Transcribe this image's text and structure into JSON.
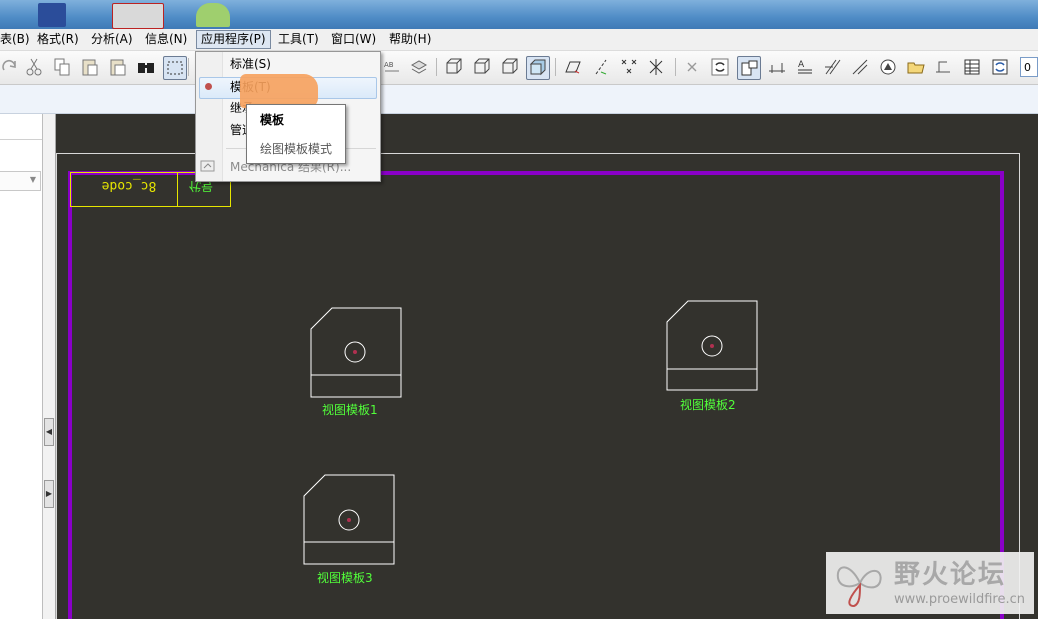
{
  "menubar": {
    "items": [
      {
        "label": "表(B)"
      },
      {
        "label": "格式(R)"
      },
      {
        "label": "分析(A)"
      },
      {
        "label": "信息(N)"
      },
      {
        "label": "应用程序(P)"
      },
      {
        "label": "工具(T)"
      },
      {
        "label": "窗口(W)"
      },
      {
        "label": "帮助(H)"
      }
    ]
  },
  "applications_menu": {
    "items": [
      {
        "label": "标准(S)"
      },
      {
        "label": "模板(T)"
      },
      {
        "label": "继承"
      },
      {
        "label": "管道"
      },
      {
        "label": "Mechanica 结果(R)..."
      }
    ]
  },
  "tooltip": {
    "title": "模板",
    "description": "绘图模板模式"
  },
  "drawing": {
    "title_block_text": "8c_code",
    "title_block_tag": "代号",
    "views": [
      {
        "label": "视图模板1"
      },
      {
        "label": "视图模板2"
      },
      {
        "label": "视图模板3"
      }
    ]
  },
  "toolbar": {
    "field_value": "0"
  },
  "watermark": {
    "title": "野火论坛",
    "url": "www.proewildfire.cn"
  },
  "colors": {
    "canvas_bg": "#33322d",
    "sheet_border": "#8a00c8",
    "drawing_lines": "#ffffff",
    "label_green": "#52ff3a",
    "title_block_yellow": "#e6e600",
    "circle_red": "#b03050",
    "highlight_orange": "#f7a15c"
  }
}
